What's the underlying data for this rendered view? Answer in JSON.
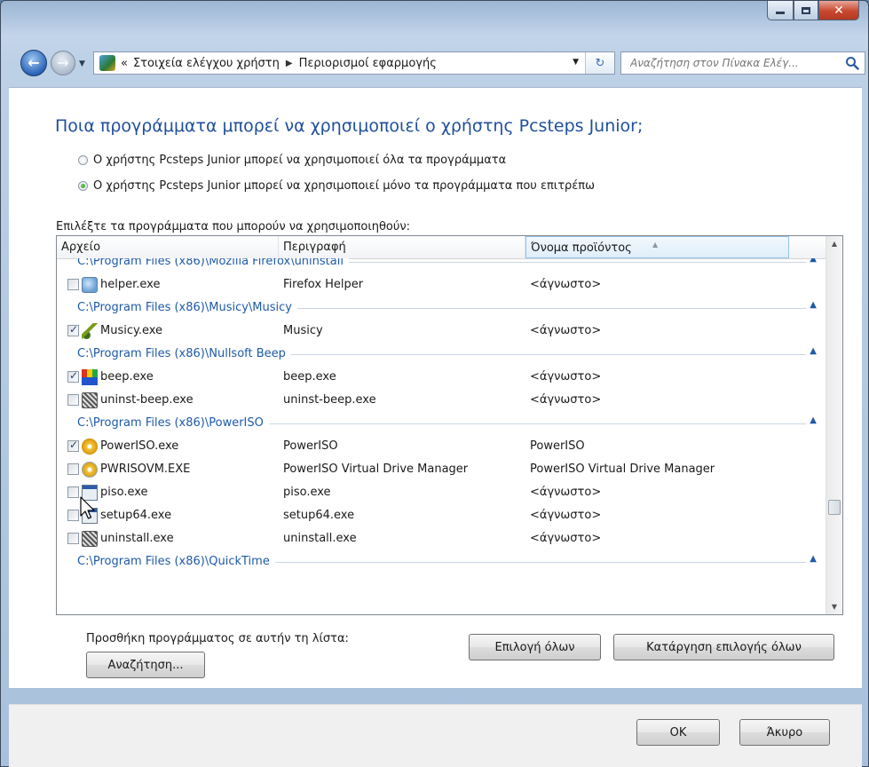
{
  "window": {
    "controls": {
      "minimize": "minimize",
      "maximize": "maximize",
      "close": "✕"
    }
  },
  "nav": {
    "breadcrumb": {
      "prefix": "«",
      "items": [
        "Στοιχεία ελέγχου χρήστη",
        "Περιορισμοί εφαρμογής"
      ],
      "separator": "▶"
    },
    "search": {
      "placeholder": "Αναζήτηση στον Πίνακα Ελέγ..."
    }
  },
  "page": {
    "heading": "Ποια προγράμματα μπορεί να χρησιμοποιεί ο χρήστης Pcsteps Junior;",
    "options": [
      {
        "label": "Ο χρήστης Pcsteps Junior μπορεί να χρησιμοποιεί όλα τα προγράμματα",
        "selected": false
      },
      {
        "label": "Ο χρήστης Pcsteps Junior μπορεί να χρησιμοποιεί μόνο τα προγράμματα που επιτρέπω",
        "selected": true
      }
    ],
    "list_label": "Επιλέξτε τα προγράμματα που μπορούν να χρησιμοποιηθούν:",
    "columns": [
      "Αρχείο",
      "Περιγραφή",
      "Όνομα προϊόντος"
    ],
    "rows": [
      {
        "kind": "group",
        "label": "C:\\Program Files (x86)\\Mozilla Firefox\\uninstall",
        "partial": "top"
      },
      {
        "kind": "file",
        "file": "helper.exe",
        "desc": "Firefox Helper",
        "product": "<άγνωστο>",
        "checked": false,
        "icon": "firefox-helper-icon"
      },
      {
        "kind": "group",
        "label": "C:\\Program Files (x86)\\Musicy\\Musicy"
      },
      {
        "kind": "file",
        "file": "Musicy.exe",
        "desc": "Musicy",
        "product": "<άγνωστο>",
        "checked": true,
        "icon": "music-note-icon"
      },
      {
        "kind": "group",
        "label": "C:\\Program Files (x86)\\Nullsoft Beep"
      },
      {
        "kind": "file",
        "file": "beep.exe",
        "desc": "beep.exe",
        "product": "<άγνωστο>",
        "checked": true,
        "icon": "beep-app-icon"
      },
      {
        "kind": "file",
        "file": "uninst-beep.exe",
        "desc": "uninst-beep.exe",
        "product": "<άγνωστο>",
        "checked": false,
        "icon": "uninstaller-icon"
      },
      {
        "kind": "group",
        "label": "C:\\Program Files (x86)\\PowerISO"
      },
      {
        "kind": "file",
        "file": "PowerISO.exe",
        "desc": "PowerISO",
        "product": "PowerISO",
        "checked": true,
        "icon": "disc-icon"
      },
      {
        "kind": "file",
        "file": "PWRISOVM.EXE",
        "desc": "PowerISO Virtual Drive Manager",
        "product": "PowerISO Virtual Drive Manager",
        "checked": false,
        "icon": "virtual-drive-icon"
      },
      {
        "kind": "file",
        "file": "piso.exe",
        "desc": "piso.exe",
        "product": "<άγνωστο>",
        "checked": false,
        "icon": "console-app-icon"
      },
      {
        "kind": "file",
        "file": "setup64.exe",
        "desc": "setup64.exe",
        "product": "<άγνωστο>",
        "checked": false,
        "icon": "console-app-icon"
      },
      {
        "kind": "file",
        "file": "uninstall.exe",
        "desc": "uninstall.exe",
        "product": "<άγνωστο>",
        "checked": false,
        "icon": "uninstaller-icon"
      },
      {
        "kind": "group",
        "label": "C:\\Program Files (x86)\\QuickTime",
        "partial": "bottom"
      }
    ],
    "add_label": "Προσθήκη προγράμματος σε αυτήν τη λίστα:",
    "browse_button": "Αναζήτηση...",
    "select_all_button": "Επιλογή όλων",
    "deselect_all_button": "Κατάργηση επιλογής όλων"
  },
  "footer": {
    "ok": "OK",
    "cancel": "Άκυρο"
  },
  "colors": {
    "heading": "#1f4f9c",
    "group_label": "#1e5aa8",
    "titlebar": "#bcd0e6"
  }
}
